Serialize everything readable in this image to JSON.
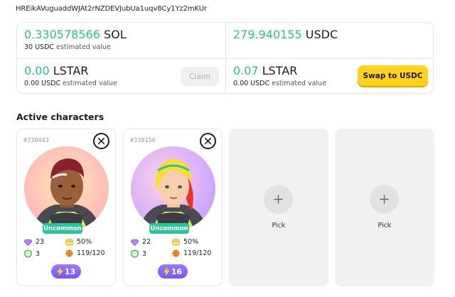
{
  "wallet": {
    "address": "HREikAVuguaddWJAt2rNZDEVJubUa1uqv8Cy1Yz2mKUr"
  },
  "balances": {
    "sol": {
      "amount": "0.330578566",
      "currency": "SOL",
      "usd": "30 USDC",
      "usd_label": "estimated value"
    },
    "usdc": {
      "amount": "279.940155",
      "currency": "USDC"
    },
    "lstar_claim": {
      "amount": "0.00",
      "currency": "LSTAR",
      "usd": "0.00 USDC",
      "usd_label": "estimated value",
      "button": "Claim"
    },
    "lstar_swap": {
      "amount": "0.07",
      "currency": "LSTAR",
      "usd": "0.00 USDC",
      "usd_label": "estimated value",
      "button": "Swap to USDC"
    }
  },
  "section": {
    "title": "Active characters"
  },
  "characters": [
    {
      "id": "#338443",
      "rarity": "Uncommon",
      "gems": "23",
      "percent": "50%",
      "shield": "3",
      "globe": "119/120",
      "energy": "13"
    },
    {
      "id": "#338156",
      "rarity": "Uncommon",
      "gems": "22",
      "percent": "50%",
      "shield": "3",
      "globe": "119/120",
      "energy": "16"
    }
  ],
  "empty_slots": [
    {
      "label": "Pick"
    },
    {
      "label": "Pick"
    }
  ],
  "colors": {
    "accent_green": "#2ec27e",
    "swap_yellow": "#ffd21f",
    "rarity_teal": "#2bc49a",
    "energy_purple": "#7a55f0"
  }
}
